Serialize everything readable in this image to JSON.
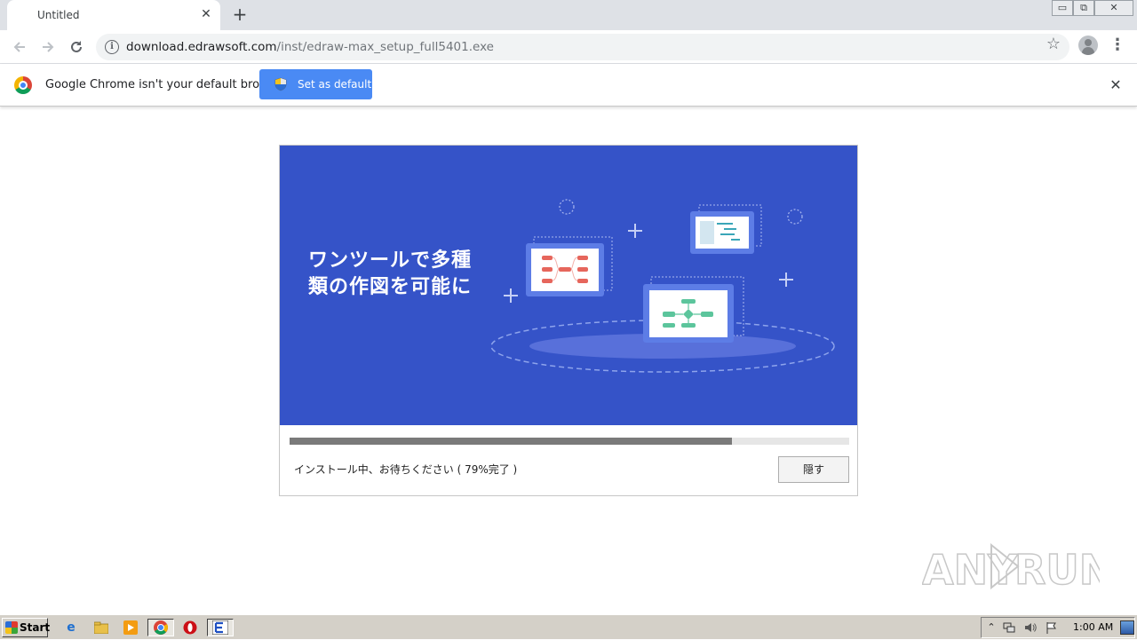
{
  "browser": {
    "tab_title": "Untitled",
    "tab_close": "✕",
    "new_tab": "+",
    "url_domain": "download.edrawsoft.com",
    "url_path": "/inst/edraw-max_setup_full5401.exe",
    "window_controls": {
      "minimize": "▭",
      "restore": "⧉",
      "close": "✕"
    }
  },
  "infobar": {
    "message": "Google Chrome isn't your default browser",
    "button_label": "Set as default",
    "close": "✕"
  },
  "installer": {
    "banner_line1": "ワンツールで多種",
    "banner_line2": "類の作図を可能に",
    "banner_color": "#3553c8",
    "progress_fraction": 0.79,
    "status_text": "インストール中、お待ちください ( 79%完了 )",
    "hide_button": "隠す"
  },
  "watermark": {
    "text": "ANY RUN"
  },
  "taskbar": {
    "start_label": "Start",
    "clock": "1:00 AM",
    "icons": [
      "ie-icon",
      "explorer-icon",
      "media-player-icon",
      "chrome-icon",
      "opera-icon",
      "edraw-installer-icon"
    ]
  }
}
